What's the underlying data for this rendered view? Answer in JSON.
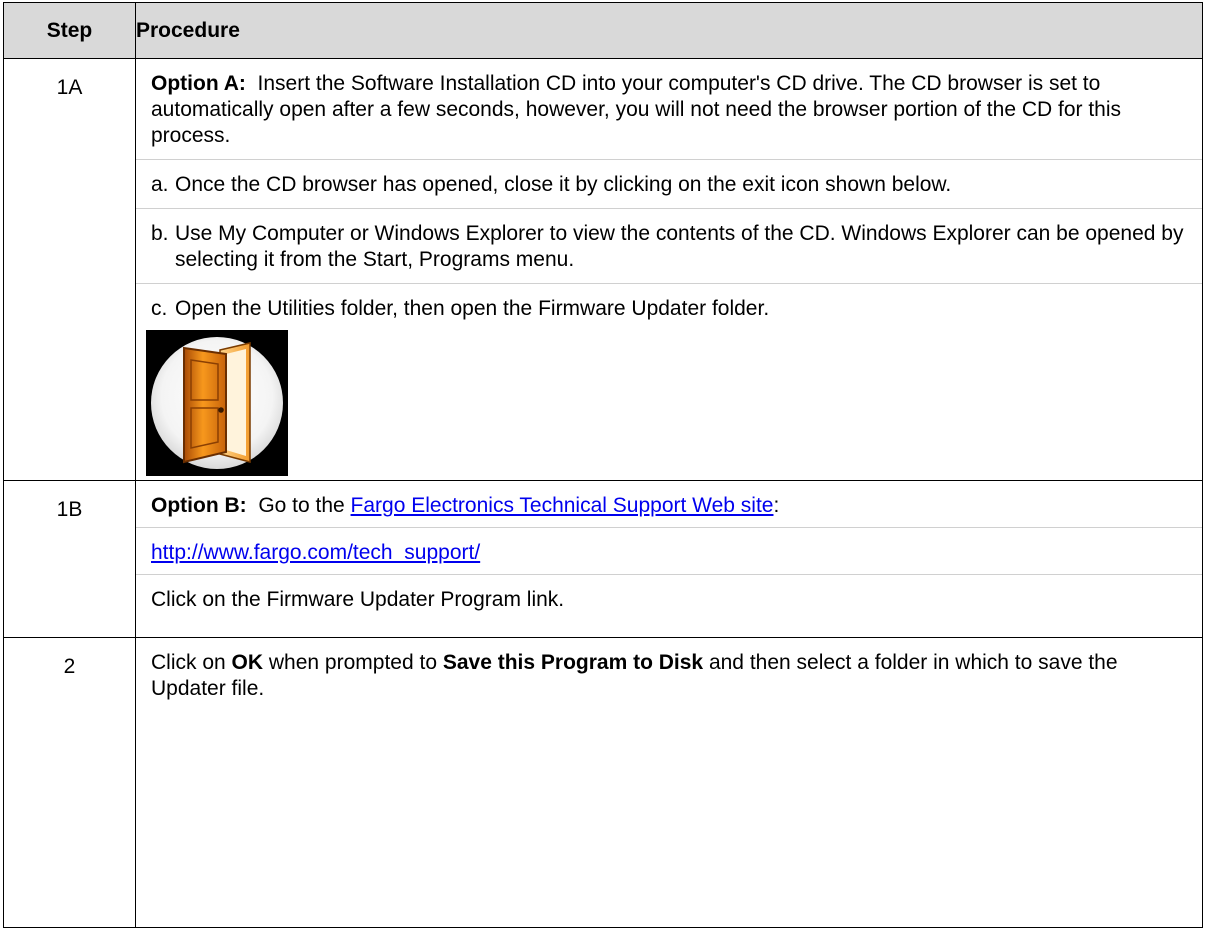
{
  "header": {
    "step": "Step",
    "procedure": "Procedure"
  },
  "rows": [
    {
      "step": "1A",
      "option_label": "Option A:",
      "option_text": "Insert the Software Installation CD into your computer's CD drive. The CD browser is set to automatically open after a few seconds, however, you will not need the browser portion of the CD for this process.",
      "items": [
        {
          "label": "a.",
          "text": "Once the CD browser has opened, close it by clicking on the exit icon shown below."
        },
        {
          "label": "b.",
          "text": "Use My Computer or Windows Explorer to view the contents of the CD. Windows Explorer can be opened by selecting it from the Start, Programs menu."
        },
        {
          "label": "c.",
          "text": "Open the Utilities folder, then open the Firmware Updater folder."
        }
      ],
      "image_icon": "exit-door-icon"
    },
    {
      "step": "1B",
      "option_label": "Option B:",
      "option_text_before": "Go to the",
      "link_text": "Fargo Electronics Technical Support Web site",
      "link_after": ":",
      "url_text": "http://www.fargo.com/tech_support/",
      "instruction": "Click on the Firmware Updater Program link."
    },
    {
      "step": "2",
      "text_1": "Click on",
      "bold_1": "OK",
      "text_2": "when prompted to",
      "bold_2": "Save this Program to Disk",
      "text_3": "and then select a folder in which to save the Updater file."
    }
  ],
  "colors": {
    "header_bg": "#d9d9d9",
    "link": "#0000ee",
    "border": "#000000"
  }
}
